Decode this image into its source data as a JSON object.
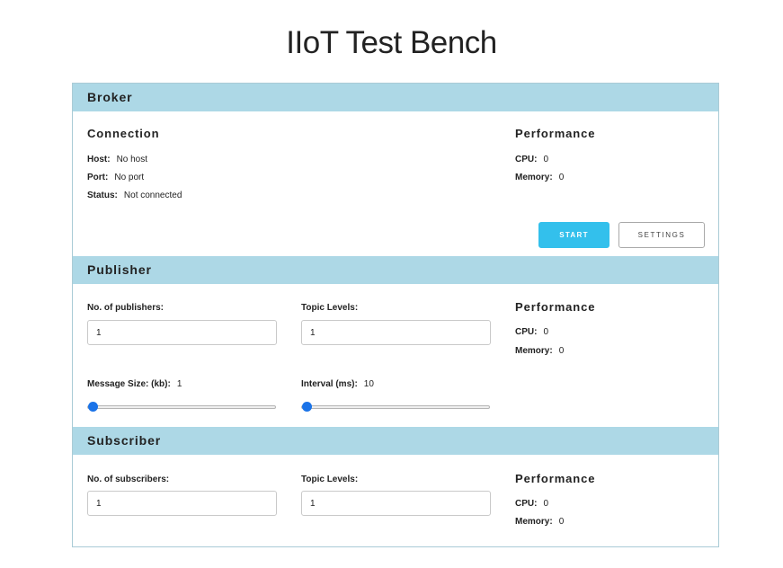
{
  "page": {
    "title": "IIoT Test Bench"
  },
  "broker": {
    "heading": "Broker",
    "connection": {
      "heading": "Connection",
      "host_label": "Host:",
      "host_value": "No host",
      "port_label": "Port:",
      "port_value": "No port",
      "status_label": "Status:",
      "status_value": "Not connected"
    },
    "performance": {
      "heading": "Performance",
      "cpu_label": "CPU:",
      "cpu_value": "0",
      "memory_label": "Memory:",
      "memory_value": "0"
    },
    "start_label": "START",
    "settings_label": "SETTINGS"
  },
  "publisher": {
    "heading": "Publisher",
    "count_label": "No. of publishers:",
    "count_value": "1",
    "topic_label": "Topic Levels:",
    "topic_value": "1",
    "message_size_label": "Message Size: (kb):",
    "message_size_value": "1",
    "interval_label": "Interval (ms):",
    "interval_value": "10",
    "performance": {
      "heading": "Performance",
      "cpu_label": "CPU:",
      "cpu_value": "0",
      "memory_label": "Memory:",
      "memory_value": "0"
    }
  },
  "subscriber": {
    "heading": "Subscriber",
    "count_label": "No. of subscribers:",
    "count_value": "1",
    "topic_label": "Topic Levels:",
    "topic_value": "1",
    "performance": {
      "heading": "Performance",
      "cpu_label": "CPU:",
      "cpu_value": "0",
      "memory_label": "Memory:",
      "memory_value": "0"
    }
  },
  "colors": {
    "band": "#add8e6",
    "start_button": "#33c0ec",
    "slider_thumb": "#1a73e8",
    "panel_border": "#aacbd6"
  }
}
